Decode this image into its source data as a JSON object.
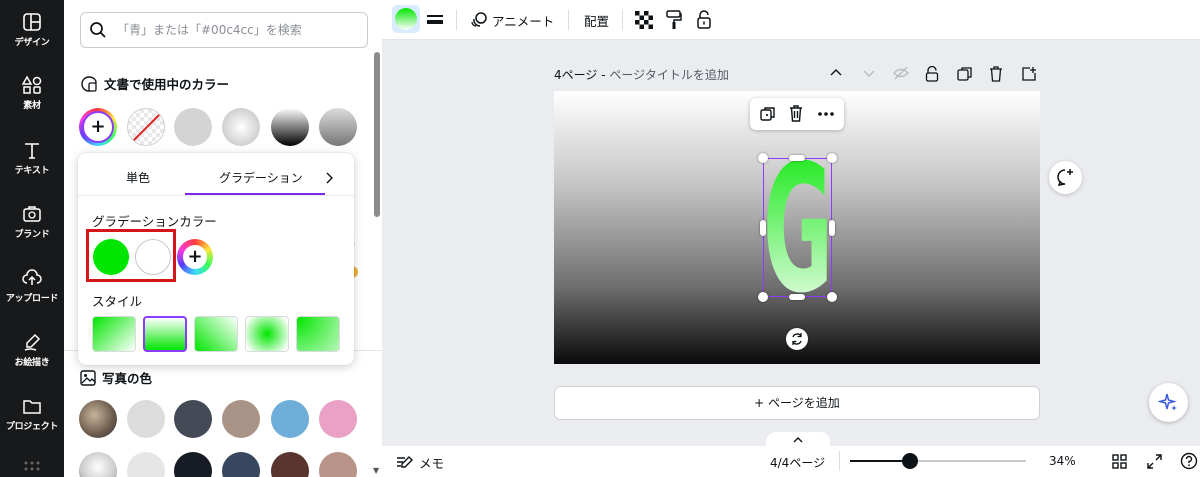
{
  "sidebar": {
    "items": [
      {
        "label": "デザイン",
        "icon": "design-icon"
      },
      {
        "label": "素材",
        "icon": "elements-icon"
      },
      {
        "label": "テキスト",
        "icon": "text-icon"
      },
      {
        "label": "ブランド",
        "icon": "brand-icon"
      },
      {
        "label": "アップロード",
        "icon": "upload-icon"
      },
      {
        "label": "お絵描き",
        "icon": "draw-icon"
      },
      {
        "label": "プロジェクト",
        "icon": "projects-icon"
      }
    ]
  },
  "panel": {
    "search_placeholder": "「青」または「#00c4cc」を検索",
    "doc_colors_title": "文書で使用中のカラー",
    "photo_colors_title": "写真の色",
    "doc_colors": [
      "add",
      "transparent",
      "#d4d4d4",
      "radial-gray",
      "linear-black",
      "linear-gray"
    ],
    "photo_row1": [
      "#dcdcdc",
      "#434a56",
      "#a99387",
      "#6eaed8",
      "#eaa1c6"
    ],
    "photo_row2": [
      "#e6e6e6",
      "#161b26",
      "#36475f",
      "#5a3530",
      "#b89388"
    ]
  },
  "popup": {
    "tab_solid": "単色",
    "tab_gradient": "グラデーション",
    "gradient_colors_label": "グラデーションカラー",
    "style_label": "スタイル",
    "stops": [
      "#00e600",
      "#ffffff"
    ],
    "selected_style_index": 1
  },
  "toolbar": {
    "animate": "アニメート",
    "position": "配置"
  },
  "canvas": {
    "page_label": "4ページ - ",
    "page_title_placeholder": "ページタイトルを追加",
    "add_page": "+ ページを追加",
    "letter": "G"
  },
  "bottom": {
    "notes": "メモ",
    "page_indicator": "4/4ページ",
    "zoom": "34%",
    "zoom_fraction": 0.34
  },
  "colors": {
    "accent": "#8b3dff",
    "highlight": "#d4161c",
    "green": "#00e600"
  }
}
